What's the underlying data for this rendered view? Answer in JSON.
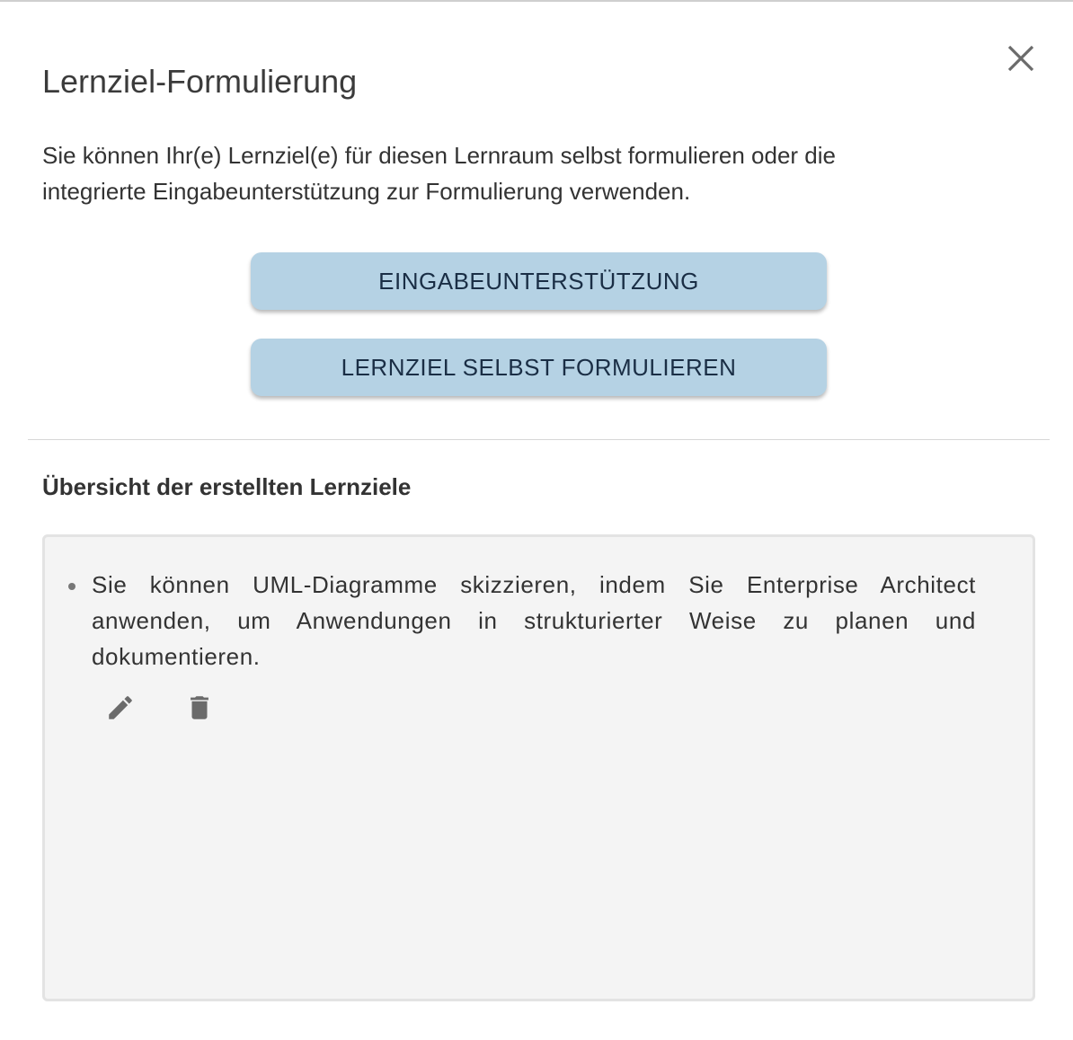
{
  "dialog": {
    "title": "Lernziel-Formulierung",
    "description": "Sie können Ihr(e) Lernziel(e) für diesen Lernraum selbst formulieren oder die integrierte Eingabeunterstützung zur Formulierung verwenden.",
    "close_icon": "close-icon"
  },
  "actions": {
    "assist_label": "EINGABEUNTERSTÜTZUNG",
    "self_label": "LERNZIEL SELBST FORMULIEREN"
  },
  "overview": {
    "heading": "Übersicht der erstellten Lernziele",
    "goals": [
      {
        "text": "Sie können UML-Diagramme skizzieren, indem Sie Enterprise Architect anwenden, um Anwendungen in strukturierter Weise zu planen und dokumentieren.",
        "edit_icon": "pencil-icon",
        "delete_icon": "trash-icon"
      }
    ]
  },
  "colors": {
    "button_bg": "#b5d2e4",
    "button_text": "#1a2e45",
    "box_bg": "#f4f4f4",
    "icon": "#6b6b6b"
  }
}
